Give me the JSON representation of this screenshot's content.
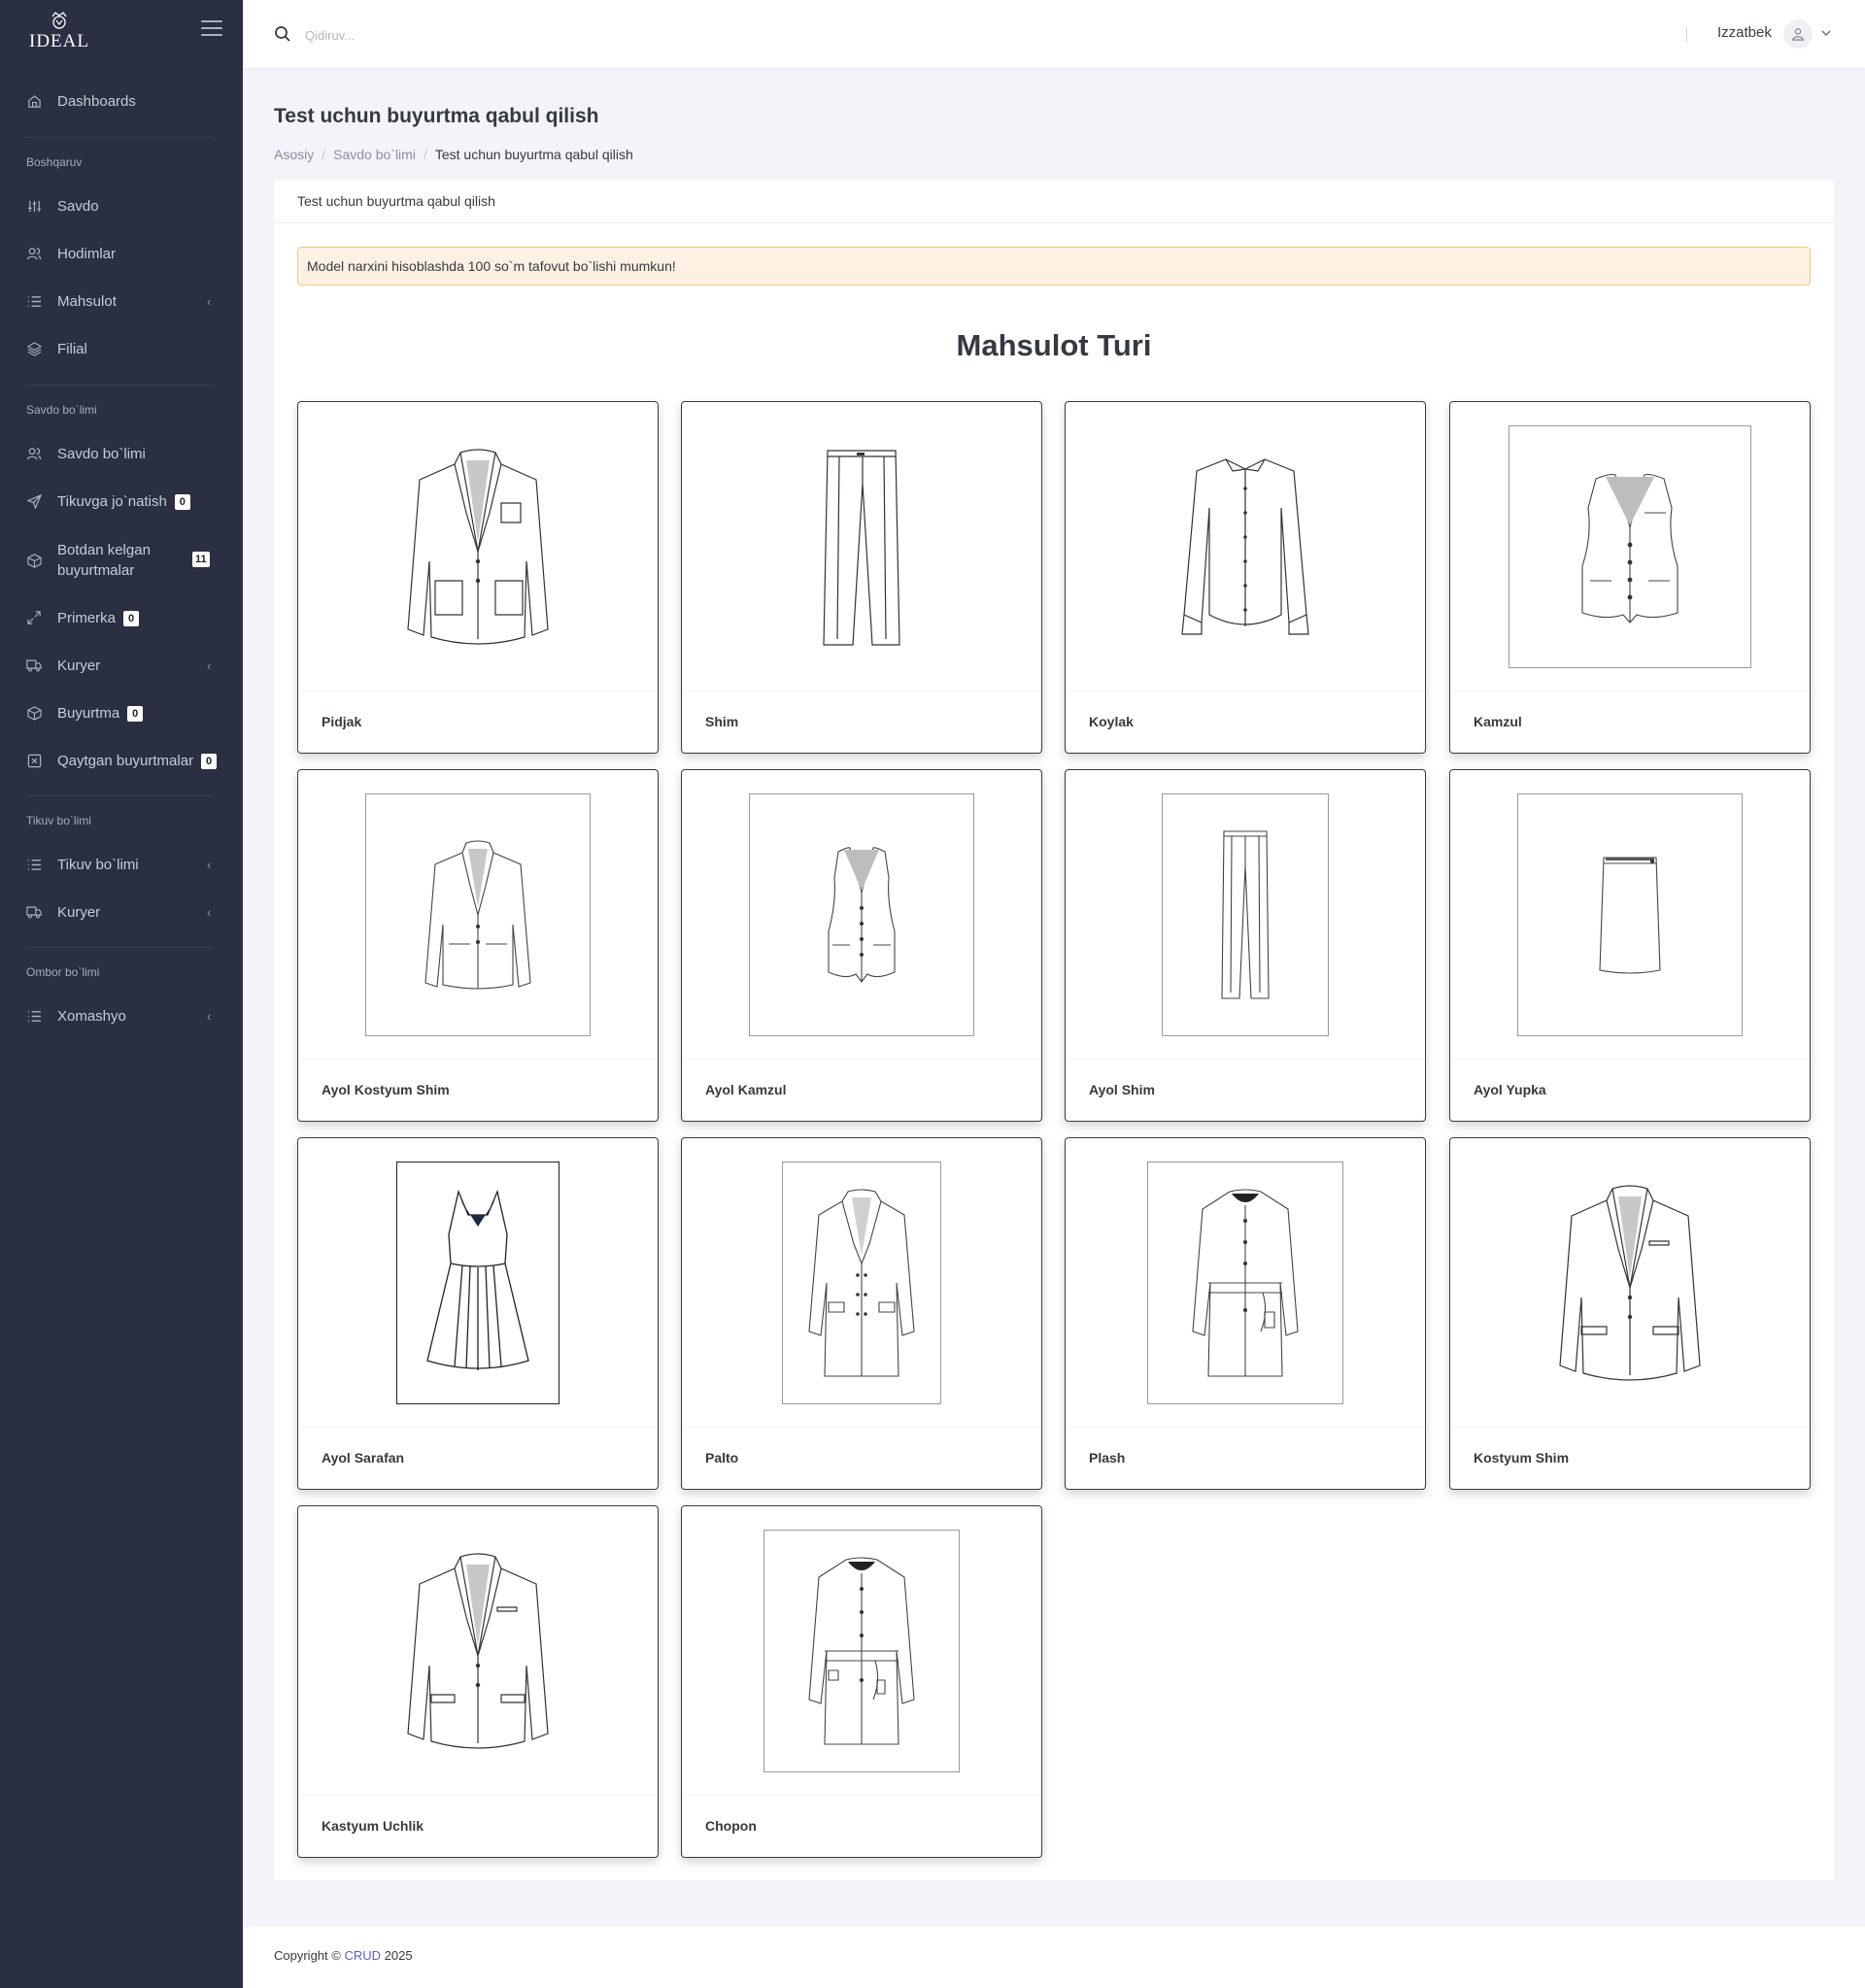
{
  "brand": {
    "logo_text": "IDEAL"
  },
  "sidebar": {
    "dashboards": "Dashboards",
    "sections": {
      "boshqaruv": "Boshqaruv",
      "savdo": "Savdo bo`limi",
      "tikuv": "Tikuv bo`limi",
      "ombor": "Ombor bo`limi"
    },
    "items": {
      "savdo": "Savdo",
      "hodimlar": "Hodimlar",
      "mahsulot": "Mahsulot",
      "filial": "Filial",
      "savdo_bolimi": "Savdo bo`limi",
      "tikuvga": "Tikuvga jo`natish",
      "tikuvga_badge": "0",
      "botdan_line1": "Botdan kelgan",
      "botdan_line2": "buyurtmalar",
      "botdan_badge": "11",
      "primerka": "Primerka",
      "primerka_badge": "0",
      "kuryer": "Kuryer",
      "buyurtma": "Buyurtma",
      "buyurtma_badge": "0",
      "qaytgan": "Qaytgan buyurtmalar",
      "qaytgan_badge": "0",
      "tikuv_bolimi": "Tikuv bo`limi",
      "kuryer2": "Kuryer",
      "xomashyo": "Xomashyo"
    }
  },
  "topbar": {
    "search_placeholder": "Qidiruv...",
    "username": "Izzatbek"
  },
  "page": {
    "title": "Test uchun buyurtma qabul qilish",
    "breadcrumb": [
      "Asosiy",
      "Savdo bo`limi",
      "Test uchun buyurtma qabul qilish"
    ]
  },
  "card": {
    "header": "Test uchun buyurtma qabul qilish",
    "alert": "Model narxini hisoblashda 100 so`m tafovut bo`lishi mumkun!",
    "section_title": "Mahsulot Turi"
  },
  "products": [
    {
      "name": "Pidjak",
      "icon": "jacket-sketch"
    },
    {
      "name": "Shim",
      "icon": "trousers-sketch"
    },
    {
      "name": "Koylak",
      "icon": "shirt-sketch"
    },
    {
      "name": "Kamzul",
      "icon": "vest-sketch"
    },
    {
      "name": "Ayol Kostyum Shim",
      "icon": "women-jacket-sketch"
    },
    {
      "name": "Ayol Kamzul",
      "icon": "women-vest-sketch"
    },
    {
      "name": "Ayol Shim",
      "icon": "women-trousers-sketch"
    },
    {
      "name": "Ayol Yupka",
      "icon": "skirt-sketch"
    },
    {
      "name": "Ayol Sarafan",
      "icon": "dress-sketch"
    },
    {
      "name": "Palto",
      "icon": "coat-sketch"
    },
    {
      "name": "Plash",
      "icon": "raincoat-sketch"
    },
    {
      "name": "Kostyum Shim",
      "icon": "suit-sketch"
    },
    {
      "name": "Kastyum Uchlik",
      "icon": "three-piece-suit-sketch"
    },
    {
      "name": "Chopon",
      "icon": "robe-sketch"
    }
  ],
  "footer": {
    "prefix": "Copyright ©",
    "link": "CRUD",
    "year": "2025"
  },
  "colors": {
    "sidebar_bg": "#2a2f42",
    "alert_bg": "#fdf1e3",
    "alert_border": "#f2c77f",
    "link": "#5b5fc7"
  }
}
